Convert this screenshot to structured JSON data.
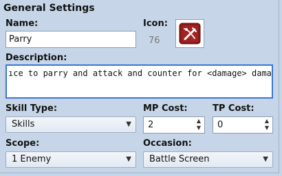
{
  "section_title": "General Settings",
  "name": {
    "label": "Name:",
    "value": "Parry"
  },
  "icon": {
    "label": "Icon:",
    "index": "76",
    "name": "parry-skill-icon",
    "colors": {
      "bg": "#8b1a1a",
      "fg": "#ffffff"
    }
  },
  "description": {
    "label": "Description:",
    "value": "ıce to parry and attack and counter for <damage> damage."
  },
  "skill_type": {
    "label": "Skill Type:",
    "value": "Skills"
  },
  "mp_cost": {
    "label": "MP Cost:",
    "value": "2"
  },
  "tp_cost": {
    "label": "TP Cost:",
    "value": "0"
  },
  "scope": {
    "label": "Scope:",
    "value": "1 Enemy"
  },
  "occasion": {
    "label": "Occasion:",
    "value": "Battle Screen"
  },
  "colors": {
    "panel": "#c6d6e8",
    "focus_border": "#3b75d6"
  }
}
